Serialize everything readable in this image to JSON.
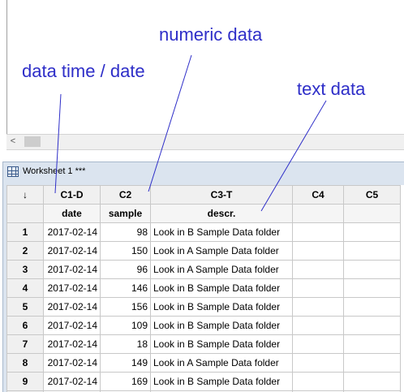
{
  "window": {
    "title": "Worksheet 1 ***"
  },
  "annotations": {
    "numeric": "numeric data",
    "datetime": "data time / date",
    "text": "text data"
  },
  "grid": {
    "corner_symbol": "↓",
    "columns": [
      {
        "id": "C1-D",
        "name": "date"
      },
      {
        "id": "C2",
        "name": "sample"
      },
      {
        "id": "C3-T",
        "name": "descr."
      },
      {
        "id": "C4",
        "name": ""
      },
      {
        "id": "C5",
        "name": ""
      }
    ],
    "rows": [
      {
        "n": "1",
        "date": "2017-02-14",
        "sample": "98",
        "descr": "Look in B Sample Data folder"
      },
      {
        "n": "2",
        "date": "2017-02-14",
        "sample": "150",
        "descr": "Look in A Sample Data folder"
      },
      {
        "n": "3",
        "date": "2017-02-14",
        "sample": "96",
        "descr": "Look in A Sample Data folder"
      },
      {
        "n": "4",
        "date": "2017-02-14",
        "sample": "146",
        "descr": "Look in B Sample Data folder"
      },
      {
        "n": "5",
        "date": "2017-02-14",
        "sample": "156",
        "descr": "Look in B Sample Data folder"
      },
      {
        "n": "6",
        "date": "2017-02-14",
        "sample": "109",
        "descr": "Look in B Sample Data folder"
      },
      {
        "n": "7",
        "date": "2017-02-14",
        "sample": "18",
        "descr": "Look in B Sample Data folder"
      },
      {
        "n": "8",
        "date": "2017-02-14",
        "sample": "149",
        "descr": "Look in A Sample Data folder"
      },
      {
        "n": "9",
        "date": "2017-02-14",
        "sample": "169",
        "descr": "Look in B Sample Data folder"
      }
    ]
  },
  "colors": {
    "annotation": "#2e2ec8",
    "title_bar": "#dbe4ef"
  }
}
